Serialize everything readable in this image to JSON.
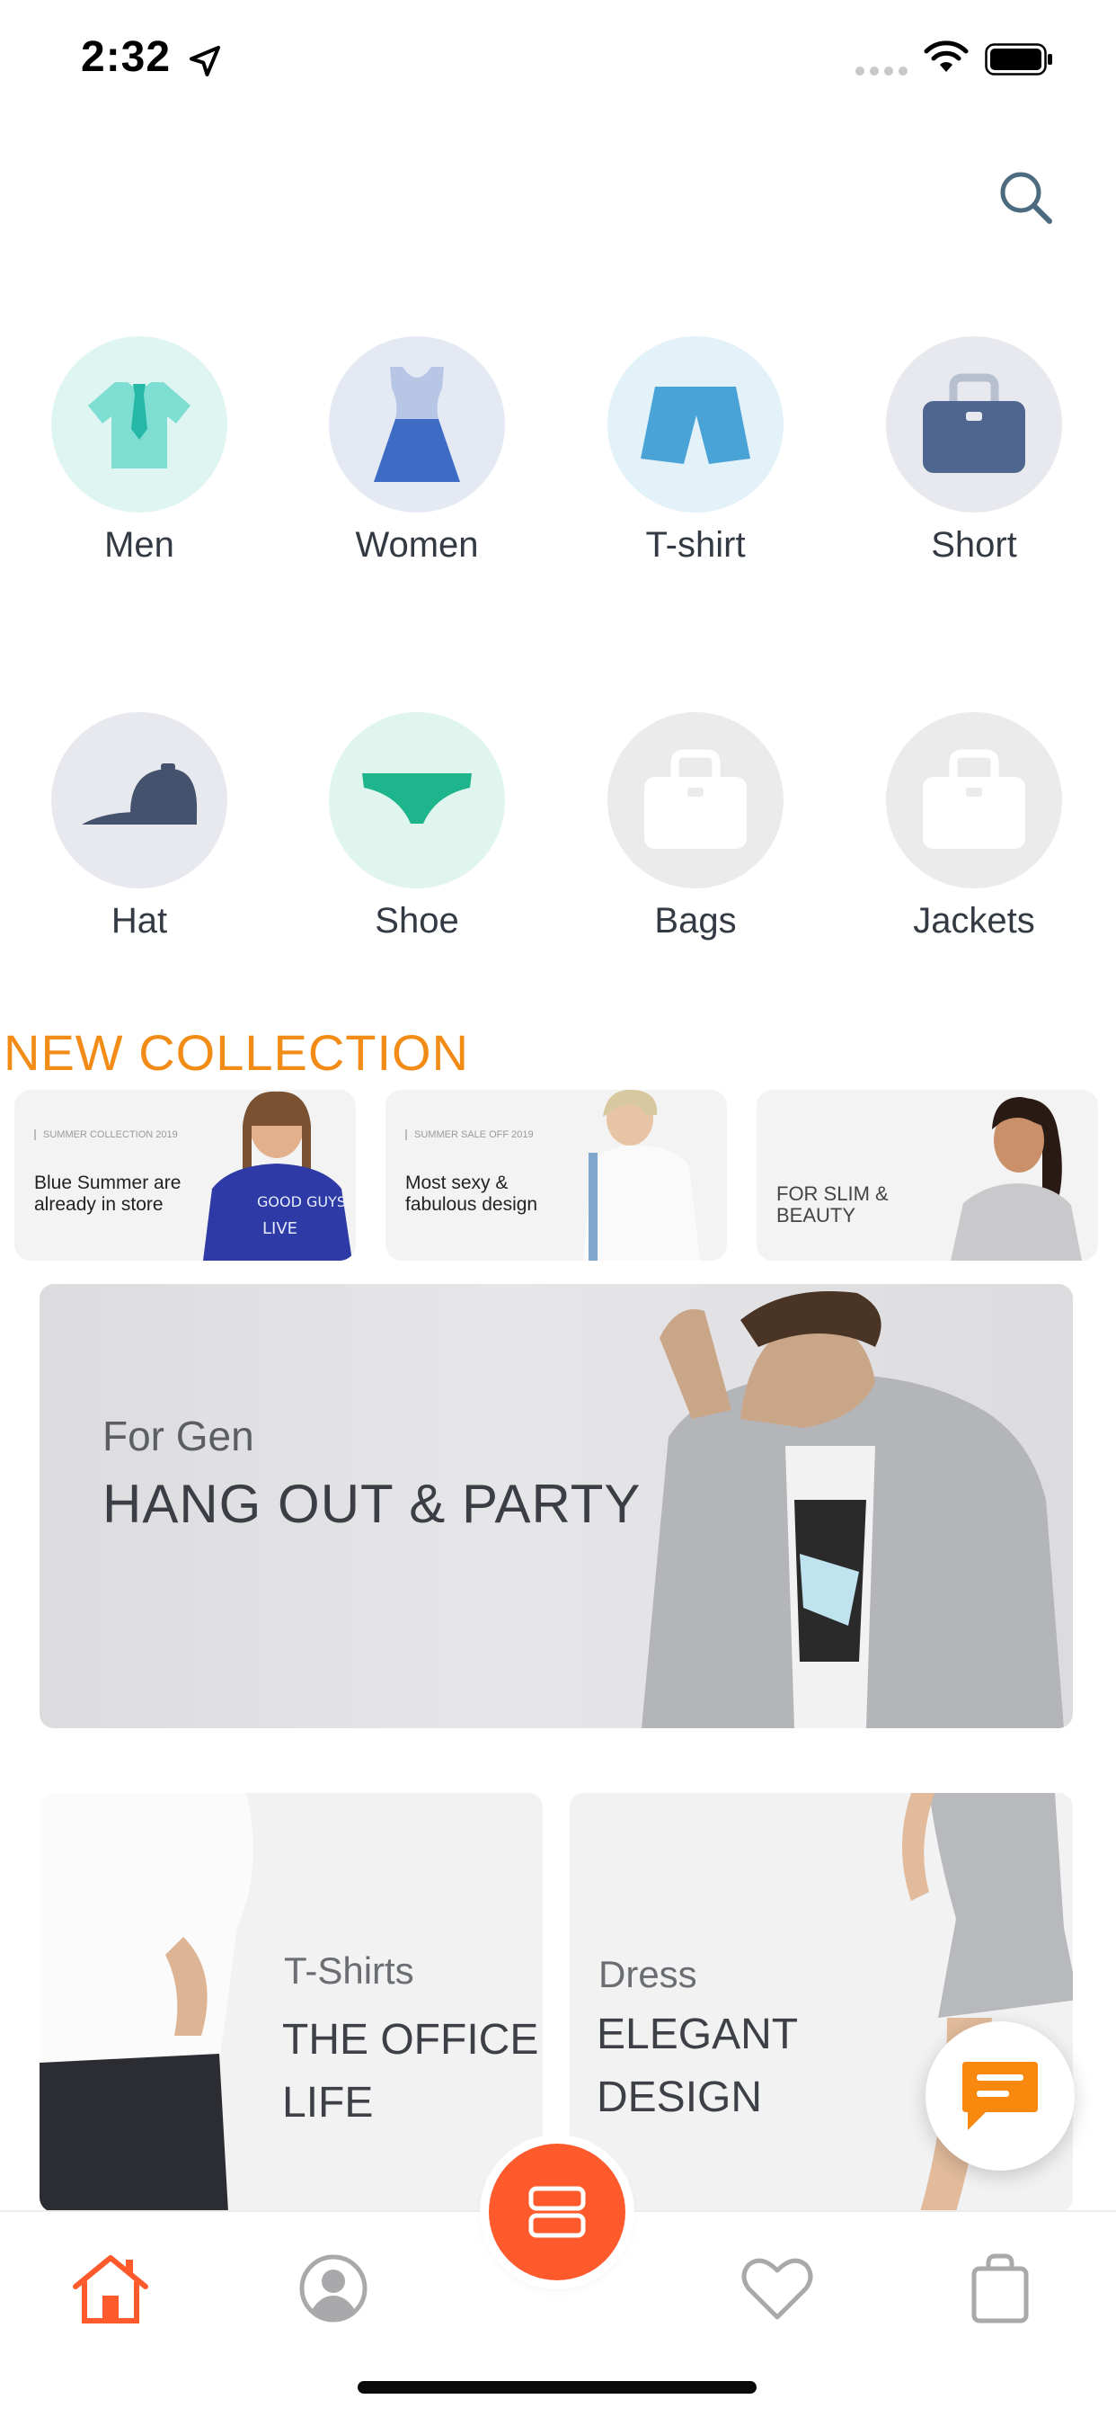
{
  "status_bar": {
    "time": "2:32"
  },
  "categories": [
    {
      "label": "Men",
      "icon": "shirt-tie-icon",
      "bg": "#dff5f1"
    },
    {
      "label": "Women",
      "icon": "dress-icon",
      "bg": "#e4e9f4"
    },
    {
      "label": "T-shirt",
      "icon": "shorts-icon",
      "bg": "#e3f1f8"
    },
    {
      "label": "Short",
      "icon": "bag-icon",
      "bg": "#e8e9ee"
    },
    {
      "label": "Hat",
      "icon": "cap-icon",
      "bg": "#e8e9ee"
    },
    {
      "label": "Shoe",
      "icon": "underwear-icon",
      "bg": "#dff5ee"
    },
    {
      "label": "Bags",
      "icon": "bag-icon",
      "bg": "#ebebeb"
    },
    {
      "label": "Jackets",
      "icon": "bag-icon",
      "bg": "#ebebeb"
    }
  ],
  "new_collection": {
    "title": "NEW COLLECTION",
    "cards": [
      {
        "tag": "SUMMER COLLECTION 2019",
        "text": "Blue Summer are already in store"
      },
      {
        "tag": "SUMMER SALE OFF 2019",
        "text": "Most sexy & fabulous design"
      },
      {
        "tag": "",
        "text": "FOR SLIM & BEAUTY"
      }
    ]
  },
  "banner": {
    "subtitle": "For Gen",
    "title": "HANG OUT & PARTY"
  },
  "promo_cards": [
    {
      "subtitle": "T-Shirts",
      "title": "THE OFFICE LIFE"
    },
    {
      "subtitle": "Dress",
      "title": "ELEGANT DESIGN"
    }
  ],
  "tab_bar": {
    "items": [
      "home-icon",
      "profile-icon",
      "catalog-icon",
      "heart-icon",
      "shopping-bag-icon"
    ],
    "active": "home-icon",
    "accent": "#ff5a2c"
  },
  "colors": {
    "section_title": "#f28c17",
    "chat_icon": "#f8890e"
  }
}
